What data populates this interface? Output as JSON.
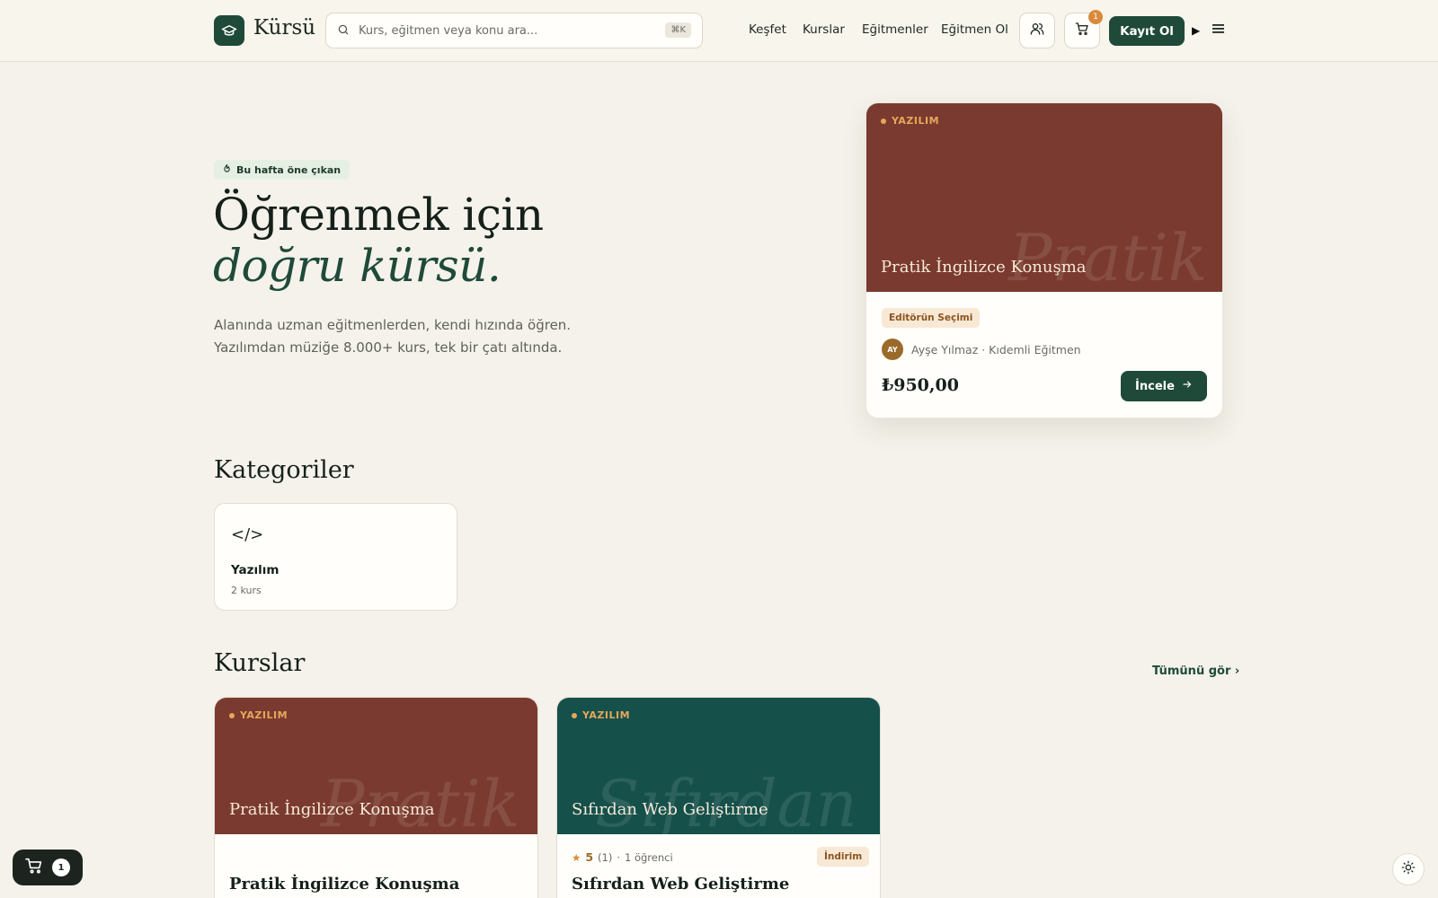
{
  "header": {
    "logo_text": "Kürsü",
    "search_placeholder": "Kurs, eğitmen veya konu ara...",
    "search_shortcut": "⌘K",
    "nav": [
      "Keşfet",
      "Kurslar",
      "Eğitmenler",
      "Eğitmen Ol"
    ],
    "cart_count": "1",
    "signup_label": "Kayıt Ol"
  },
  "hero": {
    "badge": "Bu hafta öne çıkan",
    "title_line1": "Öğrenmek için",
    "title_line2": "doğru kürsü.",
    "subtitle_line1": "Alanında uzman eğitmenlerden, kendi hızında öğren.",
    "subtitle_line2": "Yazılımdan müziğe 8.000+ kurs, tek bir çatı altında."
  },
  "featured": {
    "category": "YAZILIM",
    "cover_title": "Pratik İngilizce Konuşma",
    "watermark": "Pratik",
    "editor_badge": "Editörün Seçimi",
    "avatar_initials": "AY",
    "instructor": "Ayşe Yılmaz · Kıdemli Eğitmen",
    "price": "₺950,00",
    "cta": "İncele",
    "cover_color": "#7a3a2f"
  },
  "categories": {
    "title": "Kategoriler",
    "items": [
      {
        "icon": "</>",
        "name": "Yazılım",
        "count": "2 kurs"
      }
    ]
  },
  "courses": {
    "title": "Kurslar",
    "see_all": "Tümünü gör ›",
    "items": [
      {
        "category": "YAZILIM",
        "cover_title": "Pratik İngilizce Konuşma",
        "watermark": "Pratik",
        "title": "Pratik İngilizce Konuşma",
        "cover_color": "#7a3a2f"
      },
      {
        "category": "YAZILIM",
        "cover_title": "Sıfırdan Web Geliştirme",
        "watermark": "Sıfırdan",
        "title": "Sıfırdan Web Geliştirme",
        "rating": "5",
        "rating_count": "(1)",
        "students": "1 öğrenci",
        "badge": "İndirim",
        "cover_color": "#15504b"
      }
    ]
  },
  "floating_cart": {
    "count": "1"
  },
  "colors": {
    "primary": "#1f4a3a",
    "accent": "#d98a3b",
    "background": "#f5f2eb"
  }
}
